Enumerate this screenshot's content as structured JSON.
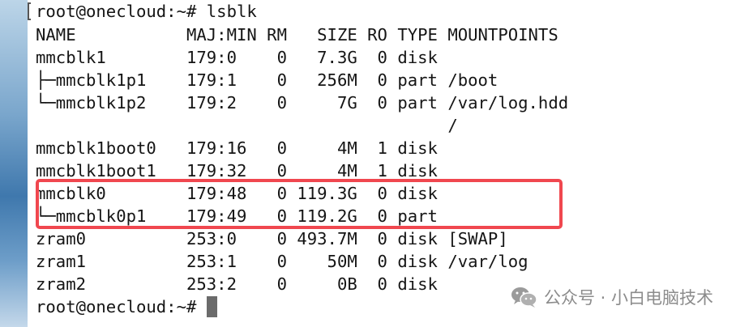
{
  "terminal": {
    "lines": [
      "root@onecloud:~# lsblk",
      "NAME           MAJ:MIN RM   SIZE RO TYPE MOUNTPOINTS",
      "mmcblk1        179:0    0   7.3G  0 disk",
      "├─mmcblk1p1    179:1    0   256M  0 part /boot",
      "└─mmcblk1p2    179:2    0     7G  0 part /var/log.hdd",
      "                                         /",
      "mmcblk1boot0   179:16   0     4M  1 disk",
      "mmcblk1boot1   179:32   0     4M  1 disk",
      "mmcblk0        179:48   0 119.3G  0 disk",
      "└─mmcblk0p1    179:49   0 119.2G  0 part",
      "zram0          253:0    0 493.7M  0 disk [SWAP]",
      "zram1          253:1    0    50M  0 disk /var/log",
      "zram2          253:2    0     0B  0 disk"
    ],
    "prompt": "root@onecloud:~# "
  },
  "watermark": {
    "icon": "wechat-icon",
    "text": "公众号 · 小白电脑技术"
  },
  "colors": {
    "highlight": "#f0474f",
    "text": "#151515",
    "cursor": "#6b6b6b"
  }
}
